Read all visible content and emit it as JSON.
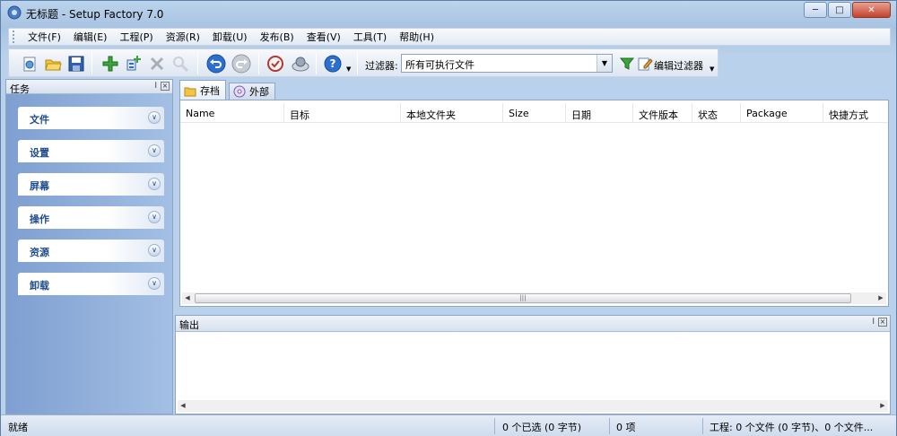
{
  "window": {
    "title": "无标题 - Setup Factory 7.0",
    "buttons": [
      "minimize",
      "maximize",
      "close"
    ]
  },
  "menubar": {
    "items": [
      "文件(F)",
      "编辑(E)",
      "工程(P)",
      "资源(R)",
      "卸载(U)",
      "发布(B)",
      "查看(V)",
      "工具(T)",
      "帮助(H)"
    ]
  },
  "toolbar": {
    "icons": [
      "new-project-icon",
      "open-icon",
      "save-icon",
      "add-file-icon",
      "add-folder-icon",
      "delete-icon",
      "find-icon",
      "undo-icon",
      "redo-icon",
      "preview-icon",
      "build-icon",
      "help-icon"
    ],
    "filter_label": "过滤器:",
    "filter_value": "所有可执行文件",
    "edit_filter_label": "编辑过滤器"
  },
  "task_panel": {
    "title": "任务",
    "groups": [
      "文件",
      "设置",
      "屏幕",
      "操作",
      "资源",
      "卸载"
    ]
  },
  "tabs": [
    {
      "label": "存档",
      "active": true
    },
    {
      "label": "外部",
      "active": false
    }
  ],
  "file_list": {
    "columns": [
      "Name",
      "目标",
      "本地文件夹",
      "Size",
      "日期",
      "文件版本",
      "状态",
      "Package",
      "快捷方式"
    ],
    "rows": []
  },
  "output_panel": {
    "title": "输出"
  },
  "statusbar": {
    "ready": "就绪",
    "selection": "0 个已选 (0 字节)",
    "items": "0 项",
    "project": "工程: 0 个文件 (0 字节)、0 个文件..."
  },
  "colors": {
    "accent": "#214d8c",
    "panel_gradient": "#7e9fd0"
  }
}
